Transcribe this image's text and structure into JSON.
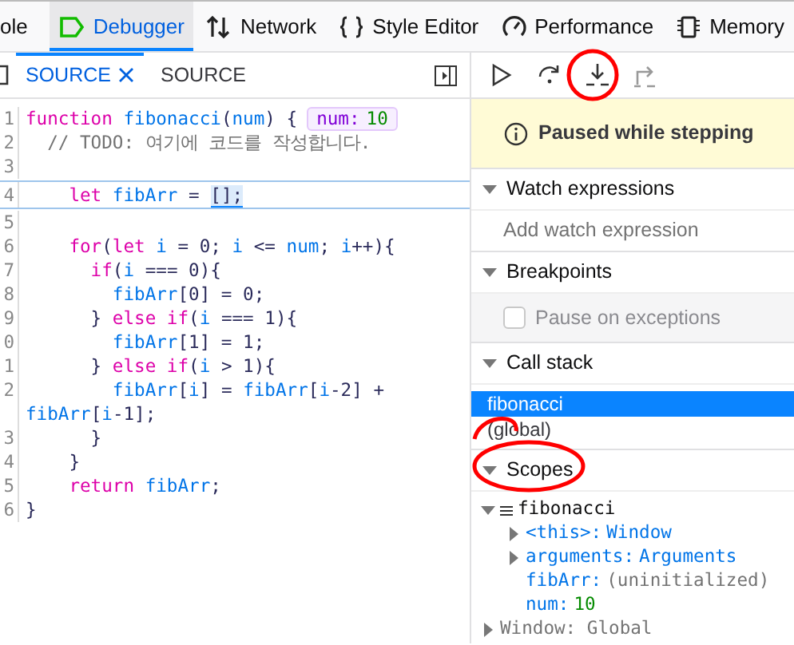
{
  "tabs": [
    {
      "label": "ole",
      "selected": false
    },
    {
      "label": "Debugger",
      "selected": true
    },
    {
      "label": "Network",
      "selected": false
    },
    {
      "label": "Style Editor",
      "selected": false
    },
    {
      "label": "Performance",
      "selected": false
    },
    {
      "label": "Memory",
      "selected": false
    }
  ],
  "source_tabs": [
    {
      "label": "SOURCE",
      "selected": true,
      "closable": true
    },
    {
      "label": "SOURCE",
      "selected": false,
      "closable": false
    }
  ],
  "code_lines": [
    {
      "number": "1",
      "paused": false,
      "tokens": [
        {
          "kind": "keyword",
          "text": "function "
        },
        {
          "kind": "name",
          "text": "fibonacci"
        },
        {
          "kind": "punct",
          "text": "("
        },
        {
          "kind": "name",
          "text": "num"
        },
        {
          "kind": "punct",
          "text": ") {"
        }
      ],
      "preview": {
        "name": "num:",
        "value": "10"
      }
    },
    {
      "number": "2",
      "paused": false,
      "tokens": [
        {
          "kind": "comment",
          "text": "  // TODO: 여기에 코드를 작성합니다."
        }
      ]
    },
    {
      "number": "3",
      "paused": false
    },
    {
      "number": "4",
      "paused": true,
      "tokens": [
        {
          "kind": "keyword",
          "text": "    let "
        },
        {
          "kind": "name",
          "text": "fibArr"
        },
        {
          "kind": "punct",
          "text": " = "
        },
        {
          "kind": "highlight",
          "text": "[];"
        }
      ]
    },
    {
      "number": "5",
      "paused": false
    },
    {
      "number": "6",
      "paused": false,
      "tokens": [
        {
          "kind": "keyword",
          "text": "    for"
        },
        {
          "kind": "punct",
          "text": "("
        },
        {
          "kind": "keyword",
          "text": "let "
        },
        {
          "kind": "name",
          "text": "i"
        },
        {
          "kind": "punct",
          "text": " = 0; "
        },
        {
          "kind": "name",
          "text": "i"
        },
        {
          "kind": "punct",
          "text": " <= "
        },
        {
          "kind": "name",
          "text": "num"
        },
        {
          "kind": "punct",
          "text": "; "
        },
        {
          "kind": "name",
          "text": "i"
        },
        {
          "kind": "punct",
          "text": "++){"
        }
      ]
    },
    {
      "number": "7",
      "paused": false,
      "tokens": [
        {
          "kind": "keyword",
          "text": "      if"
        },
        {
          "kind": "punct",
          "text": "("
        },
        {
          "kind": "name",
          "text": "i"
        },
        {
          "kind": "punct",
          "text": " === 0){"
        }
      ]
    },
    {
      "number": "8",
      "paused": false,
      "tokens": [
        {
          "kind": "name",
          "text": "        fibArr"
        },
        {
          "kind": "punct",
          "text": "[0] = 0;"
        }
      ]
    },
    {
      "number": "9",
      "paused": false,
      "tokens": [
        {
          "kind": "punct",
          "text": "      } "
        },
        {
          "kind": "keyword",
          "text": "else if"
        },
        {
          "kind": "punct",
          "text": "("
        },
        {
          "kind": "name",
          "text": "i"
        },
        {
          "kind": "punct",
          "text": " === 1){"
        }
      ]
    },
    {
      "number": "0",
      "paused": false,
      "tokens": [
        {
          "kind": "name",
          "text": "        fibArr"
        },
        {
          "kind": "punct",
          "text": "[1] = 1;"
        }
      ]
    },
    {
      "number": "1",
      "paused": false,
      "tokens": [
        {
          "kind": "punct",
          "text": "      } "
        },
        {
          "kind": "keyword",
          "text": "else if"
        },
        {
          "kind": "punct",
          "text": "("
        },
        {
          "kind": "name",
          "text": "i"
        },
        {
          "kind": "punct",
          "text": " > 1){"
        }
      ]
    },
    {
      "number": "2",
      "paused": false,
      "tokens": [
        {
          "kind": "name",
          "text": "        fibArr"
        },
        {
          "kind": "punct",
          "text": "["
        },
        {
          "kind": "name",
          "text": "i"
        },
        {
          "kind": "punct",
          "text": "] = "
        },
        {
          "kind": "name",
          "text": "fibArr"
        },
        {
          "kind": "punct",
          "text": "["
        },
        {
          "kind": "name",
          "text": "i"
        },
        {
          "kind": "punct",
          "text": "-2] +"
        }
      ]
    },
    {
      "paused": false,
      "tokens": [
        {
          "kind": "name",
          "text": "fibArr"
        },
        {
          "kind": "punct",
          "text": "["
        },
        {
          "kind": "name",
          "text": "i"
        },
        {
          "kind": "punct",
          "text": "-1];"
        }
      ]
    },
    {
      "number": "3",
      "paused": false,
      "tokens": [
        {
          "kind": "punct",
          "text": "      }"
        }
      ]
    },
    {
      "number": "4",
      "paused": false,
      "tokens": [
        {
          "kind": "punct",
          "text": "    }"
        }
      ]
    },
    {
      "number": "5",
      "paused": false,
      "tokens": [
        {
          "kind": "keyword",
          "text": "    return "
        },
        {
          "kind": "name",
          "text": "fibArr"
        },
        {
          "kind": "punct",
          "text": ";"
        }
      ]
    },
    {
      "number": "6",
      "paused": false,
      "tokens": [
        {
          "kind": "punct",
          "text": "}"
        }
      ]
    }
  ],
  "pause_banner": {
    "text": "Paused while stepping"
  },
  "sections": [
    {
      "kind": "watch",
      "title": "Watch expressions",
      "expanded": true,
      "placeholder": "Add watch expression"
    },
    {
      "kind": "breakpoints",
      "title": "Breakpoints",
      "expanded": true,
      "option": {
        "label": "Pause on exceptions",
        "checked": false
      }
    },
    {
      "kind": "callstack",
      "title": "Call stack",
      "expanded": true,
      "frames": [
        {
          "label": "fibonacci",
          "selected": true
        },
        {
          "label": "(global)",
          "selected": false
        }
      ]
    },
    {
      "kind": "scopes",
      "title": "Scopes",
      "expanded": true,
      "tree": [
        {
          "kind": "scope",
          "label": "fibonacci",
          "expanded": true,
          "children": [
            {
              "kind": "object",
              "name": "<this>:",
              "value": "Window",
              "expanded": false
            },
            {
              "kind": "object",
              "name": "arguments:",
              "value": "Arguments",
              "expanded": false
            },
            {
              "kind": "uninitialized",
              "name": "fibArr:",
              "value": "(uninitialized)"
            },
            {
              "kind": "number",
              "name": "num:",
              "value": "10"
            }
          ]
        },
        {
          "kind": "global",
          "label": "Window: Global",
          "expanded": false
        }
      ]
    }
  ]
}
